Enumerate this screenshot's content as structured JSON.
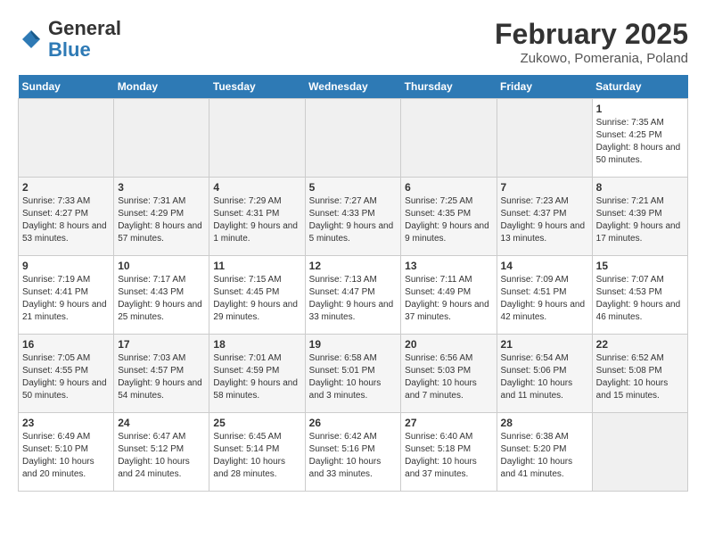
{
  "header": {
    "logo_general": "General",
    "logo_blue": "Blue",
    "main_title": "February 2025",
    "subtitle": "Zukowo, Pomerania, Poland"
  },
  "days_of_week": [
    "Sunday",
    "Monday",
    "Tuesday",
    "Wednesday",
    "Thursday",
    "Friday",
    "Saturday"
  ],
  "weeks": [
    [
      {
        "day": "",
        "info": ""
      },
      {
        "day": "",
        "info": ""
      },
      {
        "day": "",
        "info": ""
      },
      {
        "day": "",
        "info": ""
      },
      {
        "day": "",
        "info": ""
      },
      {
        "day": "",
        "info": ""
      },
      {
        "day": "1",
        "info": "Sunrise: 7:35 AM\nSunset: 4:25 PM\nDaylight: 8 hours and 50 minutes."
      }
    ],
    [
      {
        "day": "2",
        "info": "Sunrise: 7:33 AM\nSunset: 4:27 PM\nDaylight: 8 hours and 53 minutes."
      },
      {
        "day": "3",
        "info": "Sunrise: 7:31 AM\nSunset: 4:29 PM\nDaylight: 8 hours and 57 minutes."
      },
      {
        "day": "4",
        "info": "Sunrise: 7:29 AM\nSunset: 4:31 PM\nDaylight: 9 hours and 1 minute."
      },
      {
        "day": "5",
        "info": "Sunrise: 7:27 AM\nSunset: 4:33 PM\nDaylight: 9 hours and 5 minutes."
      },
      {
        "day": "6",
        "info": "Sunrise: 7:25 AM\nSunset: 4:35 PM\nDaylight: 9 hours and 9 minutes."
      },
      {
        "day": "7",
        "info": "Sunrise: 7:23 AM\nSunset: 4:37 PM\nDaylight: 9 hours and 13 minutes."
      },
      {
        "day": "8",
        "info": "Sunrise: 7:21 AM\nSunset: 4:39 PM\nDaylight: 9 hours and 17 minutes."
      }
    ],
    [
      {
        "day": "9",
        "info": "Sunrise: 7:19 AM\nSunset: 4:41 PM\nDaylight: 9 hours and 21 minutes."
      },
      {
        "day": "10",
        "info": "Sunrise: 7:17 AM\nSunset: 4:43 PM\nDaylight: 9 hours and 25 minutes."
      },
      {
        "day": "11",
        "info": "Sunrise: 7:15 AM\nSunset: 4:45 PM\nDaylight: 9 hours and 29 minutes."
      },
      {
        "day": "12",
        "info": "Sunrise: 7:13 AM\nSunset: 4:47 PM\nDaylight: 9 hours and 33 minutes."
      },
      {
        "day": "13",
        "info": "Sunrise: 7:11 AM\nSunset: 4:49 PM\nDaylight: 9 hours and 37 minutes."
      },
      {
        "day": "14",
        "info": "Sunrise: 7:09 AM\nSunset: 4:51 PM\nDaylight: 9 hours and 42 minutes."
      },
      {
        "day": "15",
        "info": "Sunrise: 7:07 AM\nSunset: 4:53 PM\nDaylight: 9 hours and 46 minutes."
      }
    ],
    [
      {
        "day": "16",
        "info": "Sunrise: 7:05 AM\nSunset: 4:55 PM\nDaylight: 9 hours and 50 minutes."
      },
      {
        "day": "17",
        "info": "Sunrise: 7:03 AM\nSunset: 4:57 PM\nDaylight: 9 hours and 54 minutes."
      },
      {
        "day": "18",
        "info": "Sunrise: 7:01 AM\nSunset: 4:59 PM\nDaylight: 9 hours and 58 minutes."
      },
      {
        "day": "19",
        "info": "Sunrise: 6:58 AM\nSunset: 5:01 PM\nDaylight: 10 hours and 3 minutes."
      },
      {
        "day": "20",
        "info": "Sunrise: 6:56 AM\nSunset: 5:03 PM\nDaylight: 10 hours and 7 minutes."
      },
      {
        "day": "21",
        "info": "Sunrise: 6:54 AM\nSunset: 5:06 PM\nDaylight: 10 hours and 11 minutes."
      },
      {
        "day": "22",
        "info": "Sunrise: 6:52 AM\nSunset: 5:08 PM\nDaylight: 10 hours and 15 minutes."
      }
    ],
    [
      {
        "day": "23",
        "info": "Sunrise: 6:49 AM\nSunset: 5:10 PM\nDaylight: 10 hours and 20 minutes."
      },
      {
        "day": "24",
        "info": "Sunrise: 6:47 AM\nSunset: 5:12 PM\nDaylight: 10 hours and 24 minutes."
      },
      {
        "day": "25",
        "info": "Sunrise: 6:45 AM\nSunset: 5:14 PM\nDaylight: 10 hours and 28 minutes."
      },
      {
        "day": "26",
        "info": "Sunrise: 6:42 AM\nSunset: 5:16 PM\nDaylight: 10 hours and 33 minutes."
      },
      {
        "day": "27",
        "info": "Sunrise: 6:40 AM\nSunset: 5:18 PM\nDaylight: 10 hours and 37 minutes."
      },
      {
        "day": "28",
        "info": "Sunrise: 6:38 AM\nSunset: 5:20 PM\nDaylight: 10 hours and 41 minutes."
      },
      {
        "day": "",
        "info": ""
      }
    ]
  ]
}
